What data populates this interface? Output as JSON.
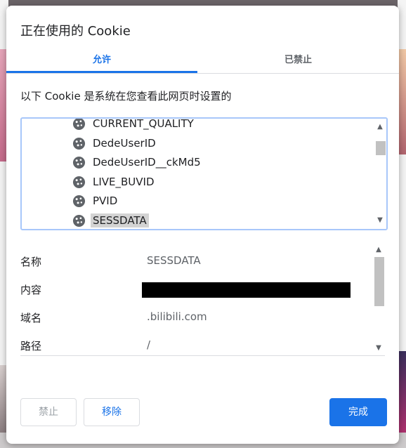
{
  "dialog": {
    "title": "正在使用的 Cookie",
    "tabs": [
      {
        "label": "允许",
        "active": true
      },
      {
        "label": "已禁止",
        "active": false
      }
    ],
    "description": "以下 Cookie 是系统在您查看此网页时设置的"
  },
  "cookies": {
    "items": [
      {
        "name": "CURRENT_QUALITY"
      },
      {
        "name": "DedeUserID"
      },
      {
        "name": "DedeUserID__ckMd5"
      },
      {
        "name": "LIVE_BUVID"
      },
      {
        "name": "PVID"
      },
      {
        "name": "SESSDATA",
        "selected": true
      }
    ],
    "icon": "cookie-icon"
  },
  "details": {
    "name_label": "名称",
    "name_value": "SESSDATA",
    "content_label": "内容",
    "domain_label": "域名",
    "domain_value": ".bilibili.com",
    "path_label": "路径",
    "path_value": "/"
  },
  "buttons": {
    "block": "禁止",
    "remove": "移除",
    "done": "完成"
  },
  "colors": {
    "accent": "#1a73e8",
    "selection": "#d3d3d3",
    "list_border": "#a8c7fa"
  }
}
